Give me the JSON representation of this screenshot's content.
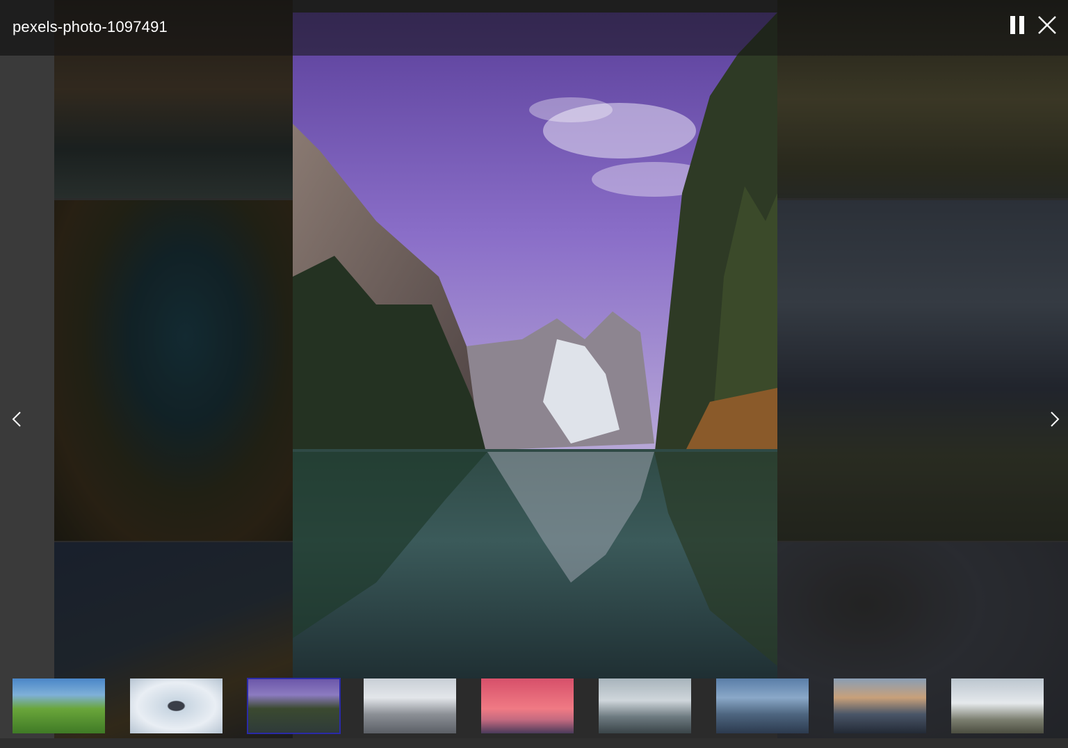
{
  "viewer": {
    "title": "pexels-photo-1097491",
    "controls": {
      "pause_icon": "pause-icon",
      "close_icon": "close-icon",
      "prev_icon": "chevron-left-icon",
      "next_icon": "chevron-right-icon"
    },
    "active_thumbnail_index": 2,
    "accent_color": "#2a2aa8"
  },
  "thumbnails": [
    {
      "subject": "green-hills"
    },
    {
      "subject": "hiker-in-snow"
    },
    {
      "subject": "mountain-lake-reflection"
    },
    {
      "subject": "snowy-peaks-clouds"
    },
    {
      "subject": "pink-sunset-sky"
    },
    {
      "subject": "misty-coastline"
    },
    {
      "subject": "jagged-mountains"
    },
    {
      "subject": "sunlit-peak"
    },
    {
      "subject": "cliff-above-clouds"
    }
  ]
}
